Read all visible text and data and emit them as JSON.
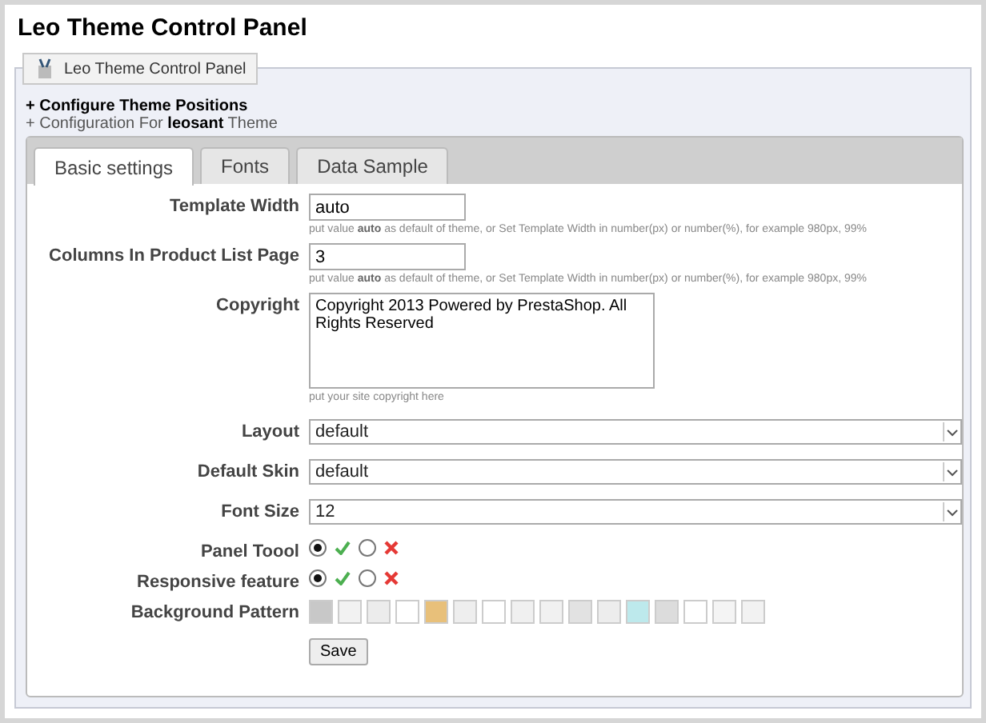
{
  "page_title": "Leo Theme Control Panel",
  "panel": {
    "legend": "Leo Theme Control Panel",
    "links": [
      "+ Configure Theme Positions",
      "+ Configuration For **leosant** Theme"
    ]
  },
  "tabs": [
    {
      "label": "Basic settings",
      "selected": true
    },
    {
      "label": "Fonts",
      "selected": false
    },
    {
      "label": "Data Sample",
      "selected": false
    }
  ],
  "fields": [
    {
      "kind": "text",
      "label": "Template Width",
      "value": "auto",
      "hint": "put value **auto** as default of theme, or Set Template Width in number(px) or number(%), for example 980px, 99%"
    },
    {
      "kind": "text",
      "label": "Columns In Product List Page",
      "value": "3",
      "hint": "put value **auto** as default of theme, or Set Template Width in number(px) or number(%), for example 980px, 99%"
    },
    {
      "kind": "textarea",
      "label": "Copyright",
      "value": "Copyright 2013 Powered by PrestaShop. All Rights Reserved",
      "hint": "put your site copyright here"
    },
    {
      "kind": "select",
      "label": "Layout",
      "value": "default"
    },
    {
      "kind": "select",
      "label": "Default Skin",
      "value": "default"
    },
    {
      "kind": "select",
      "label": "Font Size",
      "value": "12"
    },
    {
      "kind": "yesno",
      "label": "Panel Toool",
      "on": true
    },
    {
      "kind": "yesno",
      "label": "Responsive feature",
      "on": true
    },
    {
      "kind": "patterns",
      "label": "Background Pattern",
      "swatches": [
        {
          "color": "#c8c8c8"
        },
        {
          "color": "#f2f2f2"
        },
        {
          "color": "#ececec"
        },
        {
          "color": "#ffffff"
        },
        {
          "color": "#e8c07a"
        },
        {
          "color": "#eeeeee"
        },
        {
          "color": "#ffffff"
        },
        {
          "color": "#f0f0f0"
        },
        {
          "color": "#f1f1f1"
        },
        {
          "color": "#e2e2e2"
        },
        {
          "color": "#ededed"
        },
        {
          "color": "#bde9ec"
        },
        {
          "color": "#dcdcdc"
        },
        {
          "color": "#ffffff"
        },
        {
          "color": "#f4f4f4"
        },
        {
          "color": "#f2f2f2"
        }
      ]
    }
  ],
  "save_button": "Save"
}
